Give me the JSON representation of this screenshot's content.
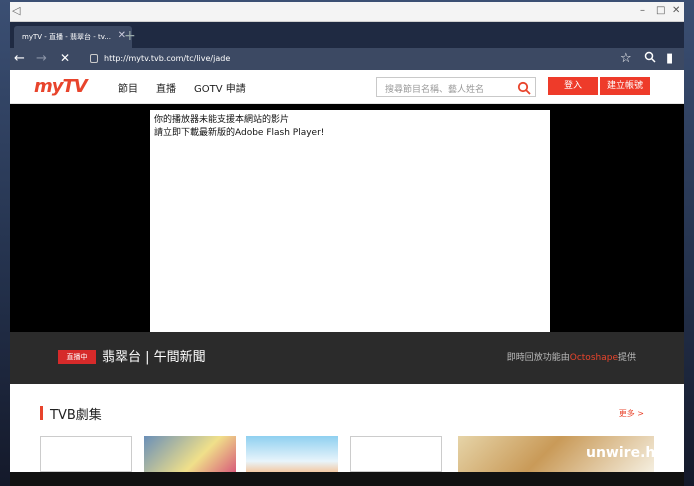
{
  "browser": {
    "tab_title": "myTV - 直播 - 翡翠台 - tv...",
    "url": "http://mytv.tvb.com/tc/live/jade"
  },
  "site": {
    "logo": "myTV",
    "nav": [
      "節目",
      "直播",
      "GOTV 申請"
    ],
    "search_placeholder": "搜尋節目名稱、藝人姓名",
    "login": "登入",
    "register": "建立帳號"
  },
  "player": {
    "flash_msg_1": "你的播放器未能支援本網站的影片",
    "flash_msg_2": "請立即下載最新版的Adobe Flash Player!"
  },
  "live": {
    "badge": "直播中",
    "channel": "翡翠台 | 午間新聞",
    "replay_prefix": "即時回放功能由",
    "replay_brand": "Octoshape",
    "replay_suffix": "提供"
  },
  "section": {
    "title": "TVB劇集",
    "more": "更多 >"
  },
  "watermark": "unwire.hk",
  "colors": {
    "accent": "#e8442c",
    "chrome": "#3c4963"
  }
}
